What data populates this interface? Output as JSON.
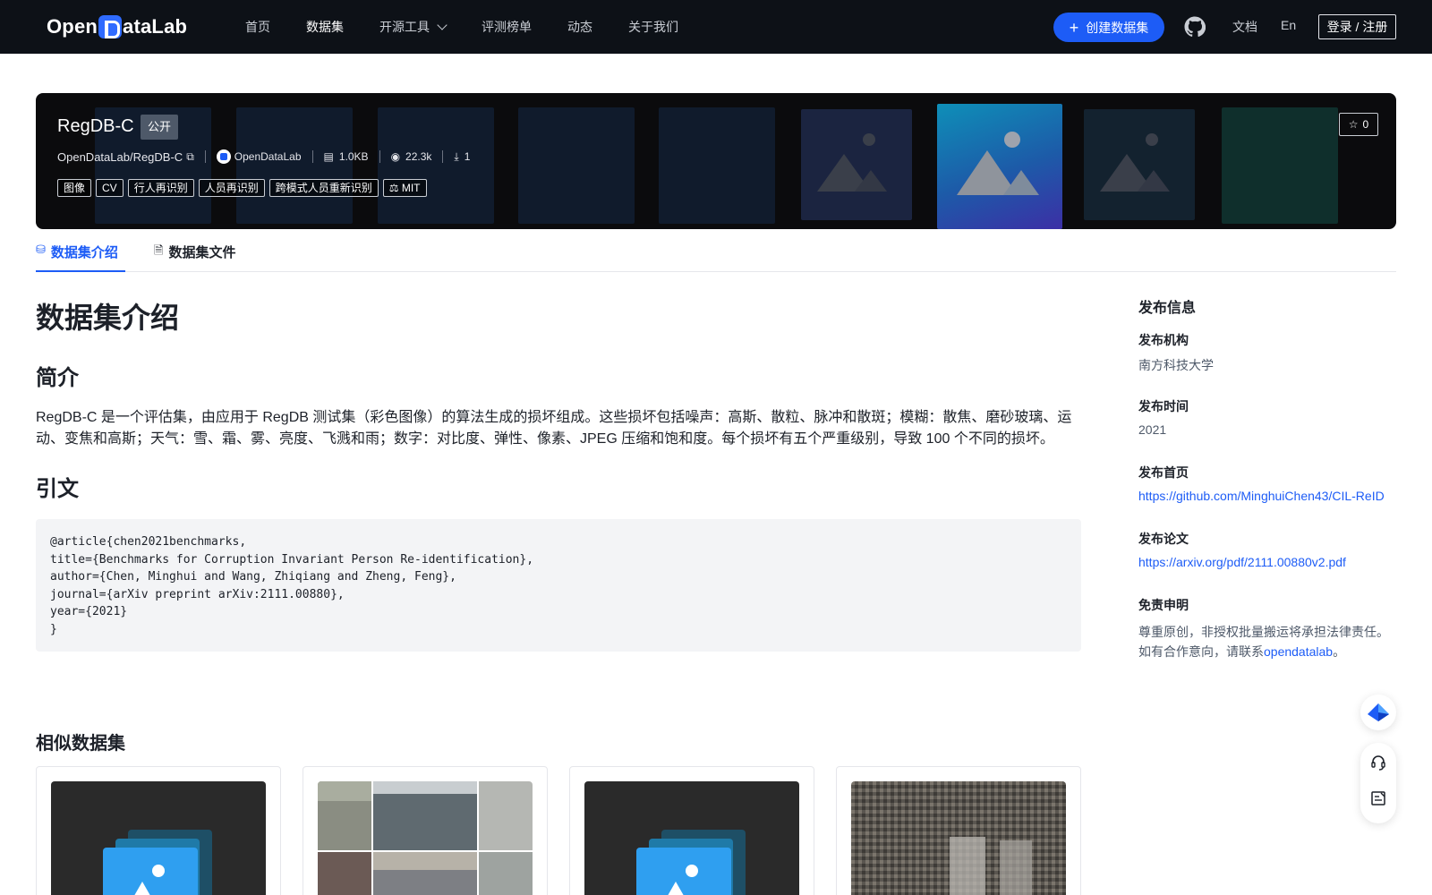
{
  "nav": {
    "logo_text": "OpenDataLab",
    "items": [
      {
        "label": "首页",
        "active": false
      },
      {
        "label": "数据集",
        "active": true
      },
      {
        "label": "开源工具",
        "active": false,
        "dropdown": true
      },
      {
        "label": "评测榜单",
        "active": false
      },
      {
        "label": "动态",
        "active": false
      },
      {
        "label": "关于我们",
        "active": false
      }
    ],
    "create_button": "创建数据集",
    "github_icon": "github-icon",
    "docs": "文档",
    "lang": "En",
    "login": "登录 / 注册"
  },
  "dataset": {
    "name": "RegDB-C",
    "visibility": "公开",
    "path": "OpenDataLab/RegDB-C",
    "publisher": "OpenDataLab",
    "size": "1.0KB",
    "views": "22.3k",
    "downloads": "1",
    "tags": [
      "图像",
      "CV",
      "行人再识别",
      "人员再识别",
      "跨模式人员重新识别"
    ],
    "license": "MIT",
    "stars": "0"
  },
  "tabs": [
    {
      "label": "数据集介绍",
      "icon": "database-icon",
      "active": true
    },
    {
      "label": "数据集文件",
      "icon": "file-icon",
      "active": false
    }
  ],
  "intro": {
    "heading": "数据集介绍",
    "summary_heading": "简介",
    "summary": "RegDB-C 是一个评估集，由应用于 RegDB 测试集（彩色图像）的算法生成的损坏组成。这些损坏包括噪声：高斯、散粒、脉冲和散斑；模糊：散焦、磨砂玻璃、运动、变焦和高斯；天气：雪、霜、雾、亮度、飞溅和雨；数字：对比度、弹性、像素、JPEG 压缩和饱和度。每个损坏有五个严重级别，导致 100 个不同的损坏。",
    "citation_heading": "引文",
    "citation_lines": [
      "@article{chen2021benchmarks,",
      "title={Benchmarks for Corruption Invariant Person Re-identification},",
      "author={Chen, Minghui and Wang, Zhiqiang and Zheng, Feng},",
      "journal={arXiv preprint arXiv:2111.00880},",
      "year={2021}",
      "}"
    ]
  },
  "sidebar": {
    "title": "发布信息",
    "org_label": "发布机构",
    "org_value": "南方科技大学",
    "time_label": "发布时间",
    "time_value": "2021",
    "homepage_label": "发布首页",
    "homepage_value": "https://github.com/MinghuiChen43/CIL-ReID",
    "paper_label": "发布论文",
    "paper_value": "https://arxiv.org/pdf/2111.00880v2.pdf",
    "disclaimer_label": "免责申明",
    "disclaimer_line1": "尊重原创，非授权批量搬运将承担法律责任。",
    "disclaimer_line2_prefix": "如有合作意向，请联系",
    "disclaimer_link": "opendatalab",
    "disclaimer_suffix": "。"
  },
  "similar": {
    "title": "相似数据集"
  },
  "colors": {
    "accent": "#1d5cf6",
    "nav_bg": "#0d1117",
    "hero_bg": "#0b0b0d"
  }
}
